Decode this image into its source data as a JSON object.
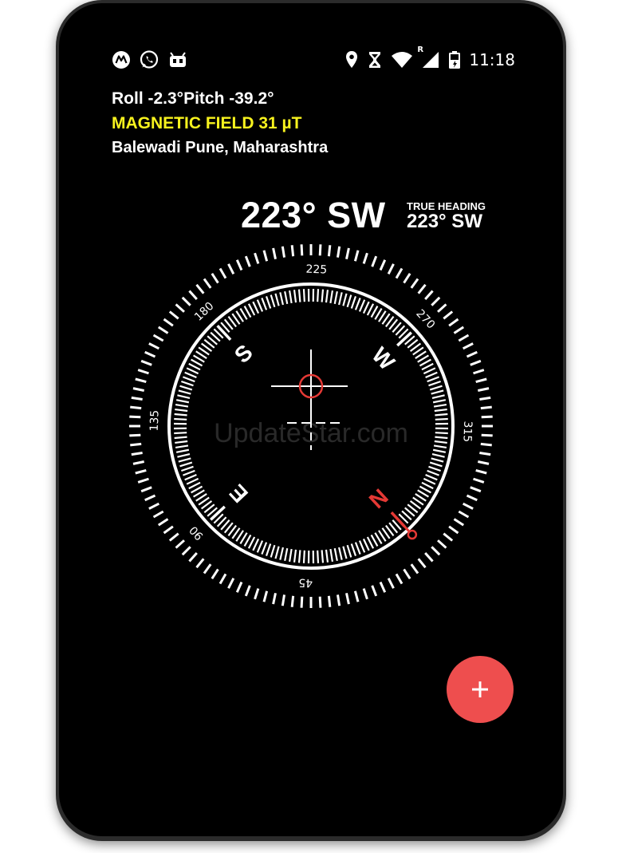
{
  "status_bar": {
    "left_icons": [
      "motorola-icon",
      "whatsapp-icon",
      "android-icon"
    ],
    "right_icons": [
      "location-icon",
      "hourglass-icon",
      "wifi-icon",
      "cell-signal-icon",
      "battery-icon"
    ],
    "roaming_indicator": "R",
    "time": "11:18"
  },
  "sensors": {
    "roll_pitch": "Roll -2.3°Pitch -39.2°",
    "magnetic_field": "MAGNETIC FIELD  31 µT",
    "location": "Balewadi Pune, Maharashtra"
  },
  "heading": {
    "magnetic": "223°  SW",
    "true_label": "TRUE HEADING",
    "true_value": "223°  SW"
  },
  "compass": {
    "rotation_deg": 223,
    "degree_labels": [
      {
        "deg": 45,
        "text": "45"
      },
      {
        "deg": 90,
        "text": "90"
      },
      {
        "deg": 135,
        "text": "135"
      },
      {
        "deg": 180,
        "text": "180"
      },
      {
        "deg": 225,
        "text": "225"
      },
      {
        "deg": 270,
        "text": "270"
      },
      {
        "deg": 315,
        "text": "315"
      }
    ],
    "cardinals": [
      {
        "deg": 0,
        "text": "N",
        "color": "#e53935"
      },
      {
        "deg": 90,
        "text": "E",
        "color": "#ffffff"
      },
      {
        "deg": 180,
        "text": "S",
        "color": "#ffffff"
      },
      {
        "deg": 270,
        "text": "W",
        "color": "#ffffff"
      }
    ],
    "north_color": "#e53935"
  },
  "watermark": "UpdateStar.com",
  "fab": {
    "icon": "plus-icon",
    "color": "#ee4e4e"
  }
}
